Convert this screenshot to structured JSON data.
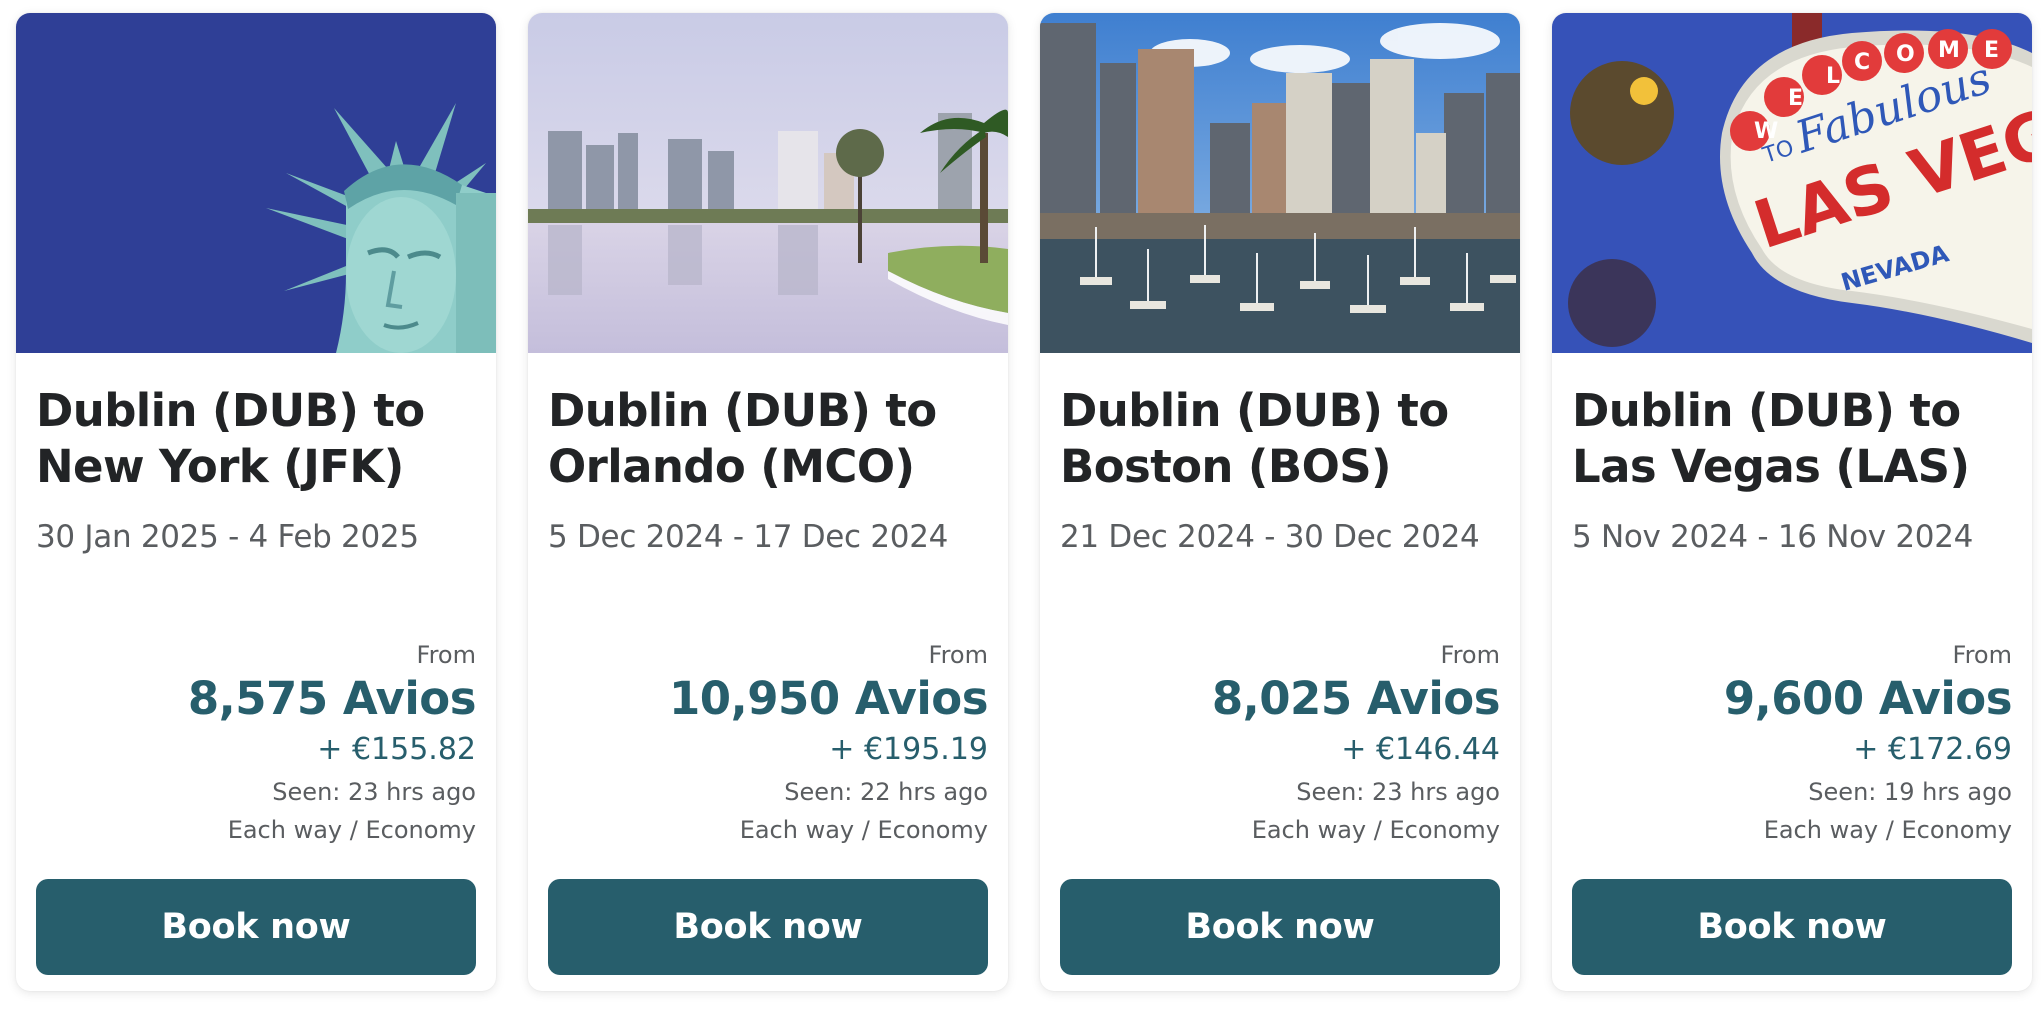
{
  "deals": [
    {
      "route": "Dublin (DUB) to New York (JFK)",
      "dates": "30 Jan 2025 - 4 Feb 2025",
      "from_label": "From",
      "avios": "8,575 Avios",
      "cash": "+ €155.82",
      "seen": "Seen: 23 hrs ago",
      "fare": "Each way / Economy",
      "book_label": "Book now",
      "image": "statue-of-liberty-photo"
    },
    {
      "route": "Dublin (DUB) to Orlando (MCO)",
      "dates": "5 Dec 2024 - 17 Dec 2024",
      "from_label": "From",
      "avios": "10,950 Avios",
      "cash": "+ €195.19",
      "seen": "Seen: 22 hrs ago",
      "fare": "Each way / Economy",
      "book_label": "Book now",
      "image": "orlando-lake-skyline-photo"
    },
    {
      "route": "Dublin (DUB) to Boston (BOS)",
      "dates": "21 Dec 2024 - 30 Dec 2024",
      "from_label": "From",
      "avios": "8,025 Avios",
      "cash": "+ €146.44",
      "seen": "Seen: 23 hrs ago",
      "fare": "Each way / Economy",
      "book_label": "Book now",
      "image": "boston-harbor-skyline-photo"
    },
    {
      "route": "Dublin (DUB) to Las Vegas (LAS)",
      "dates": "5 Nov 2024 - 16 Nov 2024",
      "from_label": "From",
      "avios": "9,600 Avios",
      "cash": "+ €172.69",
      "seen": "Seen: 19 hrs ago",
      "fare": "Each way / Economy",
      "book_label": "Book now",
      "image": "las-vegas-sign-photo",
      "sign_text": [
        "WELCOME",
        "TO",
        "Fabulous",
        "LAS VEGAS",
        "NEVADA"
      ]
    }
  ],
  "colors": {
    "accent": "#275e6c",
    "title": "#222426",
    "muted": "#5a5d60",
    "button_text": "#ffffff"
  }
}
